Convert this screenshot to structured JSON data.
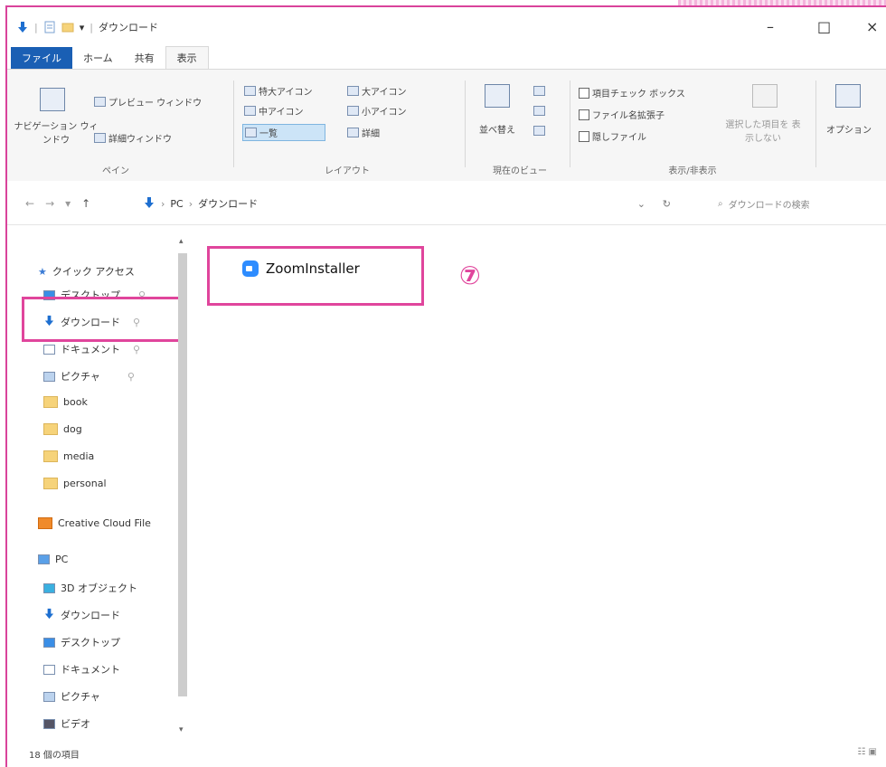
{
  "window": {
    "title": "ダウンロード",
    "minimize_glyph": "–",
    "maximize_glyph": "□",
    "close_glyph": "×"
  },
  "tabs": [
    "ファイル",
    "ホーム",
    "共有",
    "表示"
  ],
  "ribbon": {
    "pane": {
      "nav_pane": "ナビゲーション ウィンドウ",
      "preview": "プレビュー ウィンドウ",
      "details": "詳細ウィンドウ",
      "group_label": "ペイン"
    },
    "layout": {
      "items": [
        "特大アイコン",
        "大アイコン",
        "中アイコン",
        "小アイコン",
        "一覧",
        "詳細"
      ],
      "group_label": "レイアウト"
    },
    "current_view": {
      "sort": "並べ替え",
      "group_label": "現在のビュー"
    },
    "show_hide": {
      "item_checkbox": "項目チェック ボックス",
      "file_ext": "ファイル名拡張子",
      "hidden": "隠しファイル",
      "hide_selected": "選択した項目を 表示しない",
      "group_label": "表示/非表示"
    },
    "options": "オプション"
  },
  "address": {
    "path": [
      "PC",
      "ダウンロード"
    ],
    "search_placeholder": "ダウンロードの検索"
  },
  "sidebar": {
    "items": [
      {
        "label": "クイック アクセス",
        "icon": "star-icon"
      },
      {
        "label": "デスクトップ",
        "icon": "desktop-icon"
      },
      {
        "label": "ダウンロード",
        "icon": "download-arrow-icon"
      },
      {
        "label": "ドキュメント",
        "icon": "document-icon"
      },
      {
        "label": "ピクチャ",
        "icon": "picture-icon"
      },
      {
        "label": "book",
        "icon": "folder-icon"
      },
      {
        "label": "dog",
        "icon": "folder-icon"
      },
      {
        "label": "media",
        "icon": "folder-icon"
      },
      {
        "label": "personal",
        "icon": "folder-icon"
      },
      {
        "label": "Creative Cloud File",
        "icon": "creative-cloud-icon"
      },
      {
        "label": "PC",
        "icon": "pc-icon"
      },
      {
        "label": "3D オブジェクト",
        "icon": "3d-object-icon"
      },
      {
        "label": "ダウンロード",
        "icon": "download-arrow-icon"
      },
      {
        "label": "デスクトップ",
        "icon": "desktop-icon"
      },
      {
        "label": "ドキュメント",
        "icon": "document-icon"
      },
      {
        "label": "ピクチャ",
        "icon": "picture-icon"
      },
      {
        "label": "ビデオ",
        "icon": "video-icon"
      }
    ]
  },
  "content": {
    "file_name": "ZoomInstaller",
    "step_marker": "⑦"
  },
  "status": {
    "count": "18 個の項目"
  }
}
